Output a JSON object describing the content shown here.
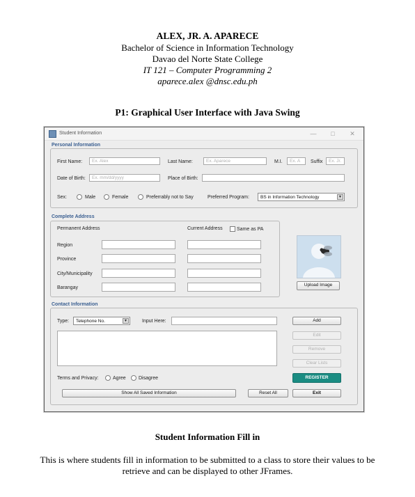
{
  "header": {
    "name": "ALEX, JR. A. APARECE",
    "degree": "Bachelor of Science in Information Technology",
    "school": "Davao del Norte State College",
    "course": "IT 121 – Computer Programming 2",
    "email": "aparece.alex @dnsc.edu.ph"
  },
  "section_title": "P1: Graphical User Interface with Java Swing",
  "window": {
    "title": "Student Information",
    "controls": {
      "minimize": "—",
      "maximize": "□",
      "close": "✕"
    },
    "personal": {
      "group_label": "Personal Information",
      "first_name_label": "First Name:",
      "first_name_placeholder": "Ex. Alex",
      "last_name_label": "Last Name:",
      "last_name_placeholder": "Ex. Aparece",
      "mi_label": "M.I.",
      "mi_placeholder": "Ex. A",
      "suffix_label": "Suffix",
      "suffix_placeholder": "Ex. Jr.",
      "dob_label": "Date of Birth:",
      "dob_placeholder": "Ex. mm/dd/yyyy",
      "pob_label": "Place of Birth:",
      "sex_label": "Sex:",
      "sex_options": [
        "Male",
        "Female",
        "Preferrably not to Say"
      ],
      "program_label": "Preferred Program:",
      "program_value": "BS in Information Technology"
    },
    "address": {
      "group_label": "Complete Address",
      "permanent_label": "Permanent Address",
      "current_label": "Current Address",
      "same_as_label": "Same as PA",
      "rows": [
        "Region",
        "Province",
        "City/Municipality",
        "Barangay"
      ],
      "upload_label": "Upload Image"
    },
    "contact": {
      "group_label": "Contact Information",
      "type_label": "Type:",
      "type_value": "Telephone No.",
      "input_label": "Input Here:",
      "add_label": "Add",
      "edit_label": "Edit",
      "remove_label": "Remove",
      "clear_label": "Clear Lists"
    },
    "terms": {
      "label": "Terms and Privacy:",
      "agree": "Agree",
      "disagree": "Disagree"
    },
    "register_label": "REGISTER",
    "show_all_label": "Show All Saved Information",
    "reset_label": "Reset All",
    "exit_label": "Exit"
  },
  "caption": "Student Information Fill in",
  "description": "This is where students fill in information to be submitted to a class to store their values to be retrieve and can be displayed to other JFrames.",
  "colors": {
    "group_label": "#3a5f91",
    "register_button": "#1a8c82"
  }
}
